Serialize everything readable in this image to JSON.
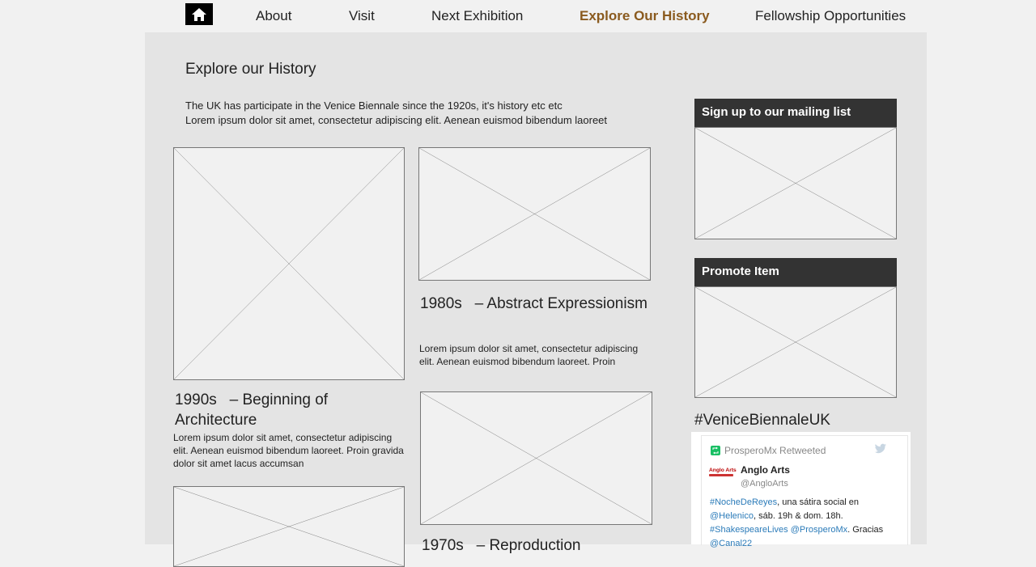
{
  "nav": {
    "items": [
      {
        "label": "About"
      },
      {
        "label": "Visit"
      },
      {
        "label": "Next Exhibition"
      },
      {
        "label": "Explore Our History"
      },
      {
        "label": "Fellowship Opportunities"
      }
    ],
    "active_color": "#8a5a1e"
  },
  "page": {
    "title": "Explore our History",
    "intro_line1": "The UK has participate in the Venice Biennale since the 1920s, it's history etc etc",
    "intro_line2": "Lorem ipsum dolor sit amet, consectetur adipiscing elit. Aenean euismod bibendum laoreet"
  },
  "cards": [
    {
      "heading_line1": "1990s   – Beginning of",
      "heading_line2": "Architecture",
      "body": "Lorem ipsum dolor sit amet, consectetur adipiscing elit. Aenean euismod bibendum laoreet. Proin gravida dolor sit amet lacus accumsan"
    },
    {
      "heading": "1980s   – Abstract Expressionism",
      "body": "Lorem ipsum dolor sit amet, consectetur adipiscing elit. Aenean euismod bibendum laoreet. Proin"
    },
    {
      "heading": "1970s   – Reproduction"
    }
  ],
  "sidebar": {
    "mailing_title": "Sign up to our mailing list",
    "promote_title": "Promote Item",
    "hashtag": "#VeniceBiennaleUK"
  },
  "tweet": {
    "retweeted_by": "ProsperoMx Retweeted",
    "name": "Anglo Arts",
    "handle": "@AngloArts",
    "avatar_text": "Anglo Arts",
    "line1_link": "#NocheDeReyes",
    "line1_rest": ", una sátira social en",
    "line2_link": "@Helenico",
    "line2_rest": ", sáb. 19h & dom. 18h.",
    "line3_link1": "#ShakespeareLives",
    "line3_link2": "@ProsperoMx",
    "line3_rest": ". Gracias",
    "line4_link": "@Canal22"
  }
}
